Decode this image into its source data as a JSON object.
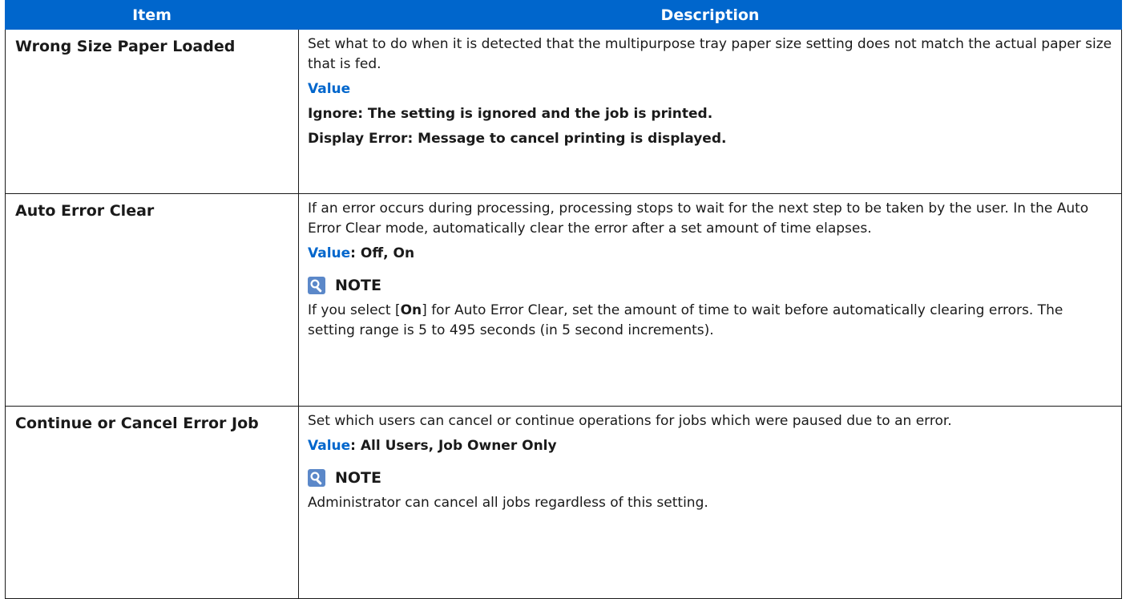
{
  "header": {
    "item": "Item",
    "description": "Description"
  },
  "colors": {
    "header_bg": "#0066cc",
    "value_label": "#0066cc",
    "icon_bg": "#5b88c9"
  },
  "rows": [
    {
      "item": "Wrong Size Paper Loaded",
      "description": "Set what to do when it is detected that the multipurpose tray paper size setting does not match the actual paper size that is fed.",
      "value_label": "Value",
      "options": [
        "Ignore: The setting is ignored and the job is printed.",
        "Display Error: Message to cancel printing is displayed."
      ]
    },
    {
      "item": "Auto Error Clear",
      "description": "If an error occurs during processing, processing stops to wait for the next step to be taken by the user. In the Auto Error Clear mode, automatically clear the error after a set amount of time elapses.",
      "value_label": "Value",
      "value_text": ": Off, On",
      "note_title": "NOTE",
      "note_icon": "note-magnifier-icon",
      "note_pre": "If you select [",
      "note_bold": "On",
      "note_post": "] for Auto Error Clear, set the amount of time to wait before automatically clearing errors. The setting range is 5 to 495 seconds (in 5 second increments)."
    },
    {
      "item": "Continue or Cancel Error Job",
      "description": "Set which users can cancel or continue operations for jobs which were paused due to an error.",
      "value_label": "Value",
      "value_text": ": All Users, Job Owner Only",
      "note_title": "NOTE",
      "note_icon": "note-magnifier-icon",
      "note_text": "Administrator can cancel all jobs regardless of this setting."
    }
  ]
}
